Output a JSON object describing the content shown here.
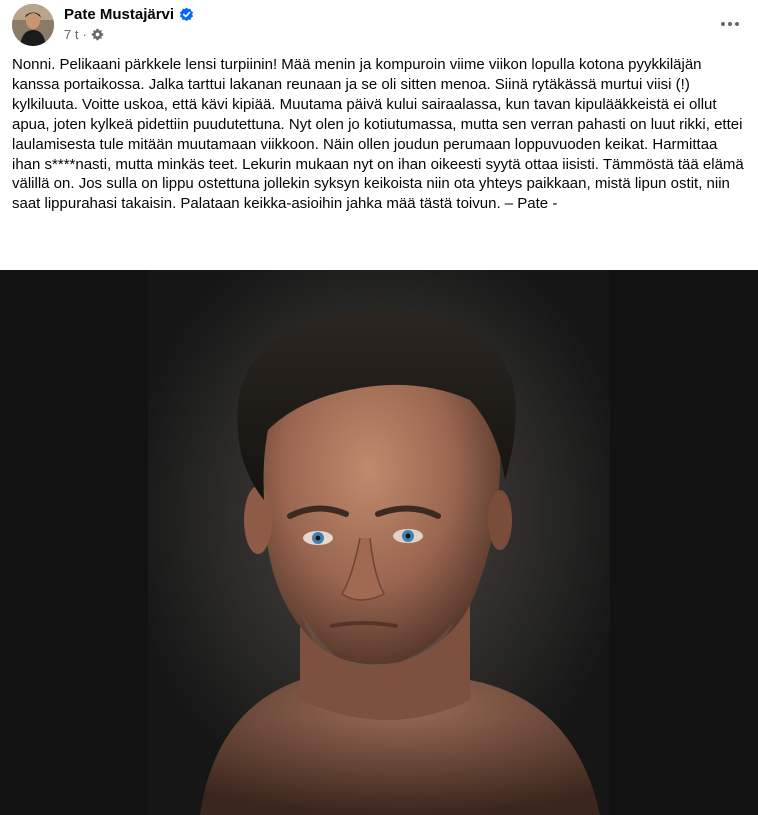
{
  "post": {
    "author": "Pate Mustajärvi",
    "verified_icon": "verified-badge-icon",
    "time": "7 t",
    "separator": "·",
    "audience_icon": "gear-icon",
    "more_icon": "more-options-icon",
    "text": "Nonni. Pelikaani pärkkele lensi turpiinin! Mää menin ja kompuroin viime viikon lopulla kotona pyykkiläjän kanssa portaikossa. Jalka tarttui lakanan reunaan ja se oli sitten menoa. Siinä rytäkässä murtui viisi (!) kylkiluuta. Voitte uskoa, että kävi kipiää. Muutama päivä kului sairaalassa, kun tavan kipulääkkeistä ei ollut apua, joten kylkeä pidettiin puudutettuna. Nyt olen jo kotiutumassa, mutta sen verran pahasti on luut rikki, ettei laulamisesta tule mitään muutamaan viikkoon. Näin ollen joudun perumaan loppuvuoden keikat. Harmittaa ihan s****nasti, mutta minkäs teet. Lekurin mukaan nyt on ihan oikeesti syytä ottaa iisisti. Tämmöstä tää elämä välillä on. Jos sulla on lippu ostettuna jollekin syksyn keikoista niin ota yhteys paikkaan, mistä lipun ostit, niin saat lippurahasi takaisin. Palataan keikka-asioihin jahka mää tästä toivun. – Pate -"
  },
  "colors": {
    "accent": "#0866ff",
    "secondary_text": "#65676b",
    "photo_background": "#141414"
  }
}
